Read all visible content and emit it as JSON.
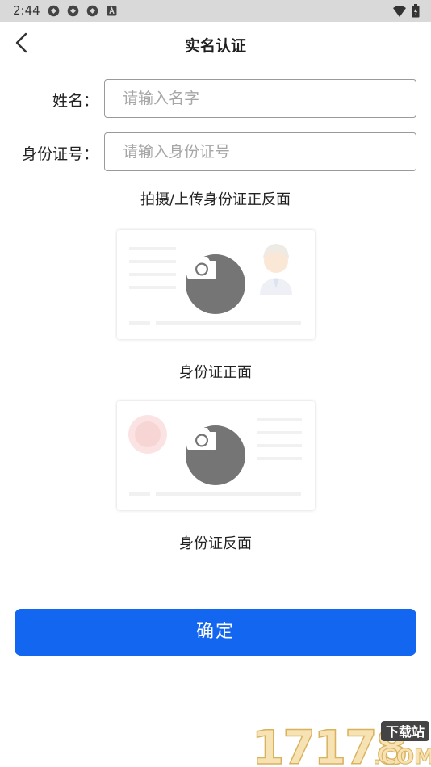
{
  "status_bar": {
    "time": "2:44",
    "left_icons": [
      "sync-icon",
      "sync-icon",
      "sync-icon",
      "a-badge-icon"
    ],
    "right_icons": [
      "wifi-icon",
      "battery-icon"
    ]
  },
  "header": {
    "title": "实名认证",
    "back_icon": "chevron-left-icon"
  },
  "form": {
    "name": {
      "label": "姓名：",
      "placeholder": "请输入名字",
      "value": ""
    },
    "id_number": {
      "label": "身份证号：",
      "placeholder": "请输入身份证号",
      "value": ""
    }
  },
  "upload": {
    "instruction": "拍摄/上传身份证正反面",
    "front": {
      "caption": "身份证正面",
      "icon": "camera-icon"
    },
    "back": {
      "caption": "身份证反面",
      "icon": "camera-icon"
    }
  },
  "confirm_label": "确定",
  "watermark": {
    "text": "17178",
    "badge": "下载站",
    "suffix": ".COM"
  },
  "colors": {
    "primary": "#1366f0",
    "status_bar": "#d9d9d9",
    "camera_circle": "#757575",
    "input_border": "#9a9a9a",
    "placeholder": "#a6a6a6"
  }
}
